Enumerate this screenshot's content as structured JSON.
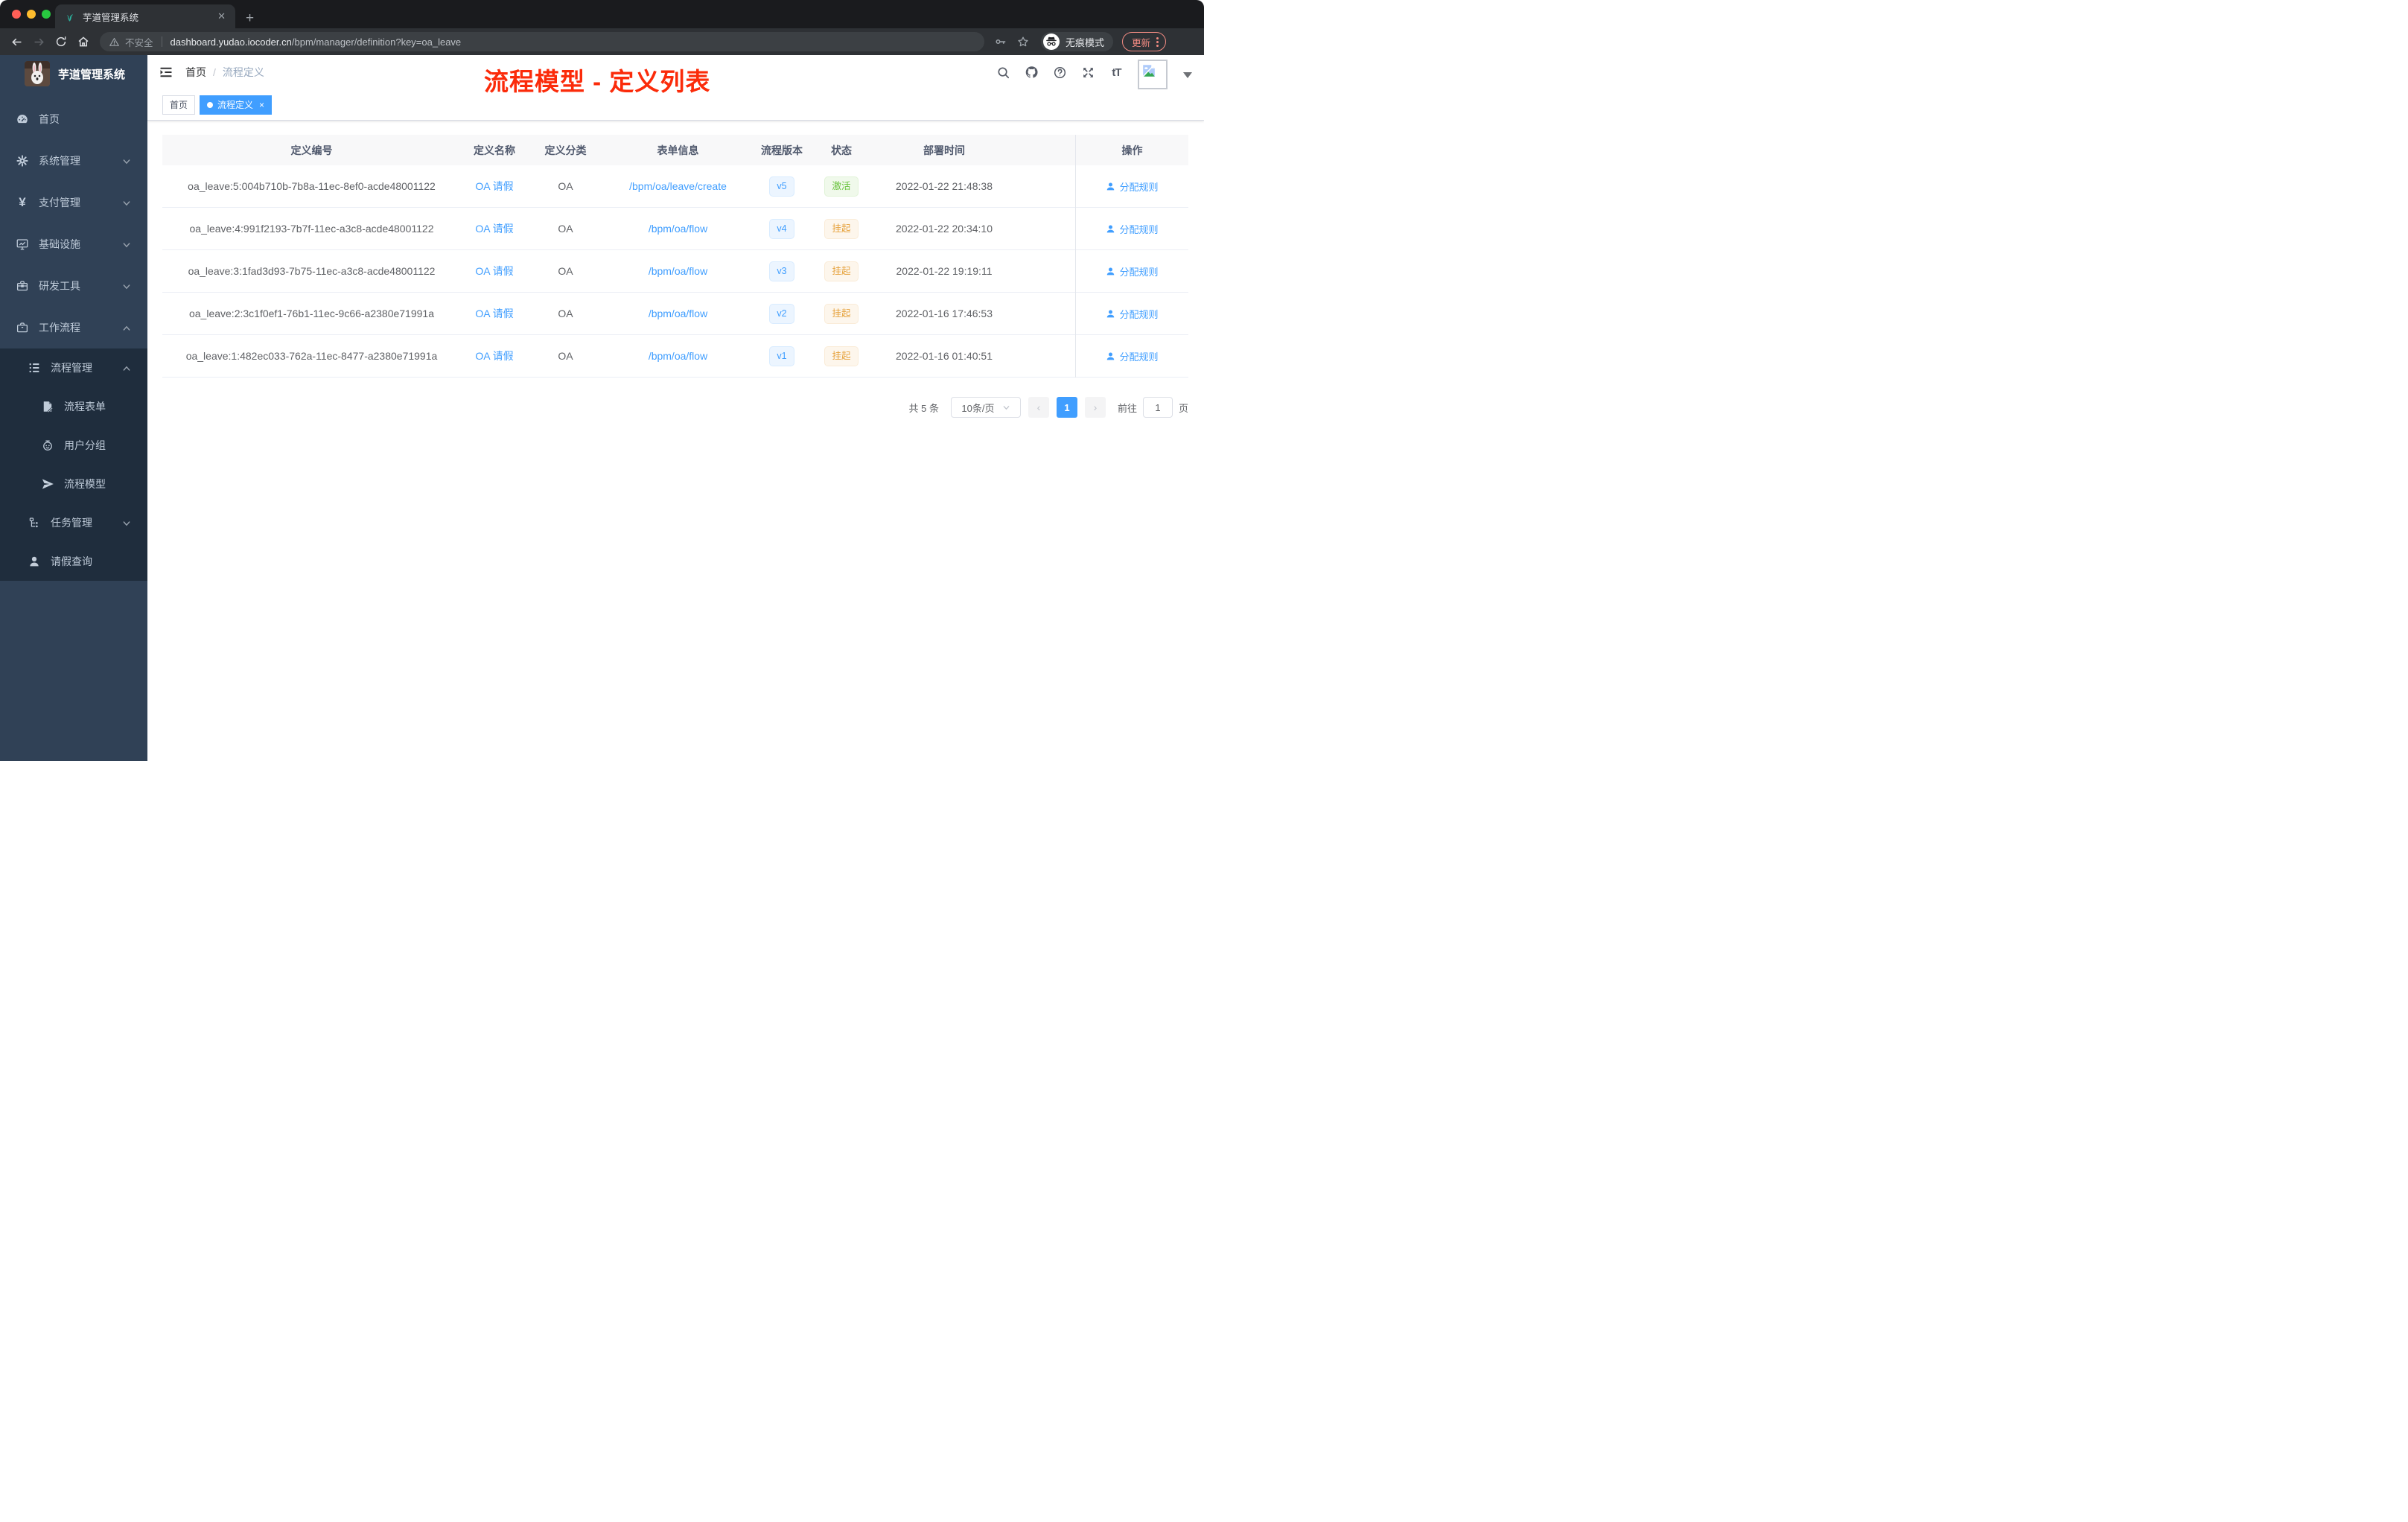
{
  "browser": {
    "window_controls": {
      "close": "close",
      "minimize": "minimize",
      "maximize": "maximize"
    },
    "tab": {
      "title": "芋道管理系统",
      "favicon": "sprout-icon",
      "close_glyph": "✕",
      "new_tab_glyph": "+"
    },
    "toolbar": {
      "security_label": "不安全",
      "url_domain": "dashboard.yudao.iocoder.cn",
      "url_path": "/bpm/manager/definition?key=oa_leave",
      "incognito_label": "无痕模式",
      "update_label": "更新"
    }
  },
  "sidebar": {
    "app_title": "芋道管理系统",
    "menu": [
      {
        "key": "home",
        "label": "首页",
        "icon": "dashboard-icon",
        "level": 1,
        "chevron": "",
        "dark": false
      },
      {
        "key": "system-management",
        "label": "系统管理",
        "icon": "gear-icon",
        "level": 1,
        "chevron": "down",
        "dark": false
      },
      {
        "key": "payment-management",
        "label": "支付管理",
        "icon": "yen-icon",
        "level": 1,
        "chevron": "down",
        "dark": false
      },
      {
        "key": "infrastructure",
        "label": "基础设施",
        "icon": "monitor-icon",
        "level": 1,
        "chevron": "down",
        "dark": false
      },
      {
        "key": "dev-tools",
        "label": "研发工具",
        "icon": "toolbox-icon",
        "level": 1,
        "chevron": "down",
        "dark": false
      },
      {
        "key": "workflow",
        "label": "工作流程",
        "icon": "briefcase-icon",
        "level": 1,
        "chevron": "up",
        "dark": false
      },
      {
        "key": "process-management",
        "label": "流程管理",
        "icon": "flow-list-icon",
        "level": 2,
        "chevron": "up",
        "dark": true
      },
      {
        "key": "process-form",
        "label": "流程表单",
        "icon": "form-doc-icon",
        "level": 3,
        "chevron": "",
        "dark": true
      },
      {
        "key": "user-group",
        "label": "用户分组",
        "icon": "user-group-icon",
        "level": 3,
        "chevron": "",
        "dark": true
      },
      {
        "key": "process-model",
        "label": "流程模型",
        "icon": "paper-plane-icon",
        "level": 3,
        "chevron": "",
        "dark": true
      },
      {
        "key": "task-management",
        "label": "任务管理",
        "icon": "task-tree-icon",
        "level": 2,
        "chevron": "down",
        "dark": true
      },
      {
        "key": "leave-query",
        "label": "请假查询",
        "icon": "person-icon",
        "level": 2,
        "chevron": "",
        "dark": true
      }
    ]
  },
  "navbar": {
    "breadcrumb": {
      "home": "首页",
      "separator": "/",
      "current": "流程定义"
    },
    "annotation": "流程模型 - 定义列表"
  },
  "tags": [
    {
      "label": "首页",
      "active": false,
      "closable": false
    },
    {
      "label": "流程定义",
      "active": true,
      "closable": true,
      "close_glyph": "×"
    }
  ],
  "table": {
    "columns": [
      "定义编号",
      "定义名称",
      "定义分类",
      "表单信息",
      "流程版本",
      "状态",
      "部署时间",
      "操作"
    ],
    "rows": [
      {
        "id": "oa_leave:5:004b710b-7b8a-11ec-8ef0-acde48001122",
        "name": "OA 请假",
        "category": "OA",
        "form": "/bpm/oa/leave/create",
        "version": "v5",
        "status": "激活",
        "status_type": "success",
        "deploy_time": "2022-01-22 21:48:38",
        "action": "分配规则"
      },
      {
        "id": "oa_leave:4:991f2193-7b7f-11ec-a3c8-acde48001122",
        "name": "OA 请假",
        "category": "OA",
        "form": "/bpm/oa/flow",
        "version": "v4",
        "status": "挂起",
        "status_type": "warning",
        "deploy_time": "2022-01-22 20:34:10",
        "action": "分配规则"
      },
      {
        "id": "oa_leave:3:1fad3d93-7b75-11ec-a3c8-acde48001122",
        "name": "OA 请假",
        "category": "OA",
        "form": "/bpm/oa/flow",
        "version": "v3",
        "status": "挂起",
        "status_type": "warning",
        "deploy_time": "2022-01-22 19:19:11",
        "action": "分配规则"
      },
      {
        "id": "oa_leave:2:3c1f0ef1-76b1-11ec-9c66-a2380e71991a",
        "name": "OA 请假",
        "category": "OA",
        "form": "/bpm/oa/flow",
        "version": "v2",
        "status": "挂起",
        "status_type": "warning",
        "deploy_time": "2022-01-16 17:46:53",
        "action": "分配规则"
      },
      {
        "id": "oa_leave:1:482ec033-762a-11ec-8477-a2380e71991a",
        "name": "OA 请假",
        "category": "OA",
        "form": "/bpm/oa/flow",
        "version": "v1",
        "status": "挂起",
        "status_type": "warning",
        "deploy_time": "2022-01-16 01:40:51",
        "action": "分配规则"
      }
    ]
  },
  "pagination": {
    "total": "共 5 条",
    "page_size": "10条/页",
    "prev_glyph": "‹",
    "next_glyph": "›",
    "current_page": "1",
    "goto_label": "前往",
    "goto_value": "1",
    "goto_unit": "页"
  },
  "colors": {
    "accent": "#409eff",
    "success": "#67c23a",
    "warning": "#e6a23c",
    "annotation_red": "#fb2b0a",
    "sidebar_bg": "#304156",
    "submenu_bg": "#1f2d3d"
  }
}
